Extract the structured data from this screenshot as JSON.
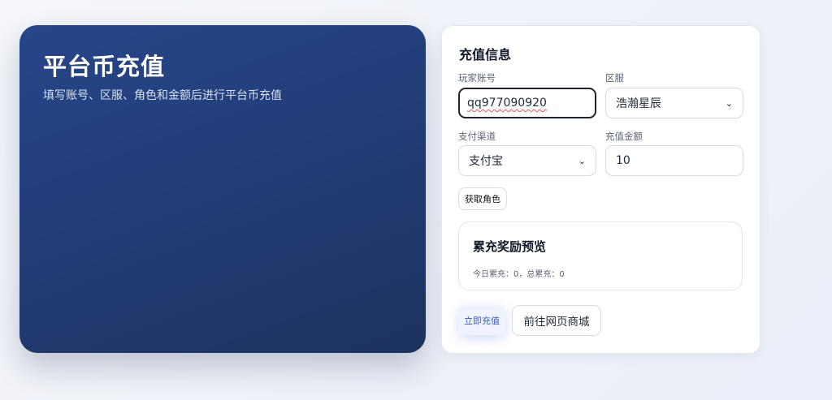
{
  "hero": {
    "title": "平台币充值",
    "subtitle": "填写账号、区服、角色和金额后进行平台币充值"
  },
  "form": {
    "title": "充值信息",
    "account_label": "玩家账号",
    "account_value": "qq977090920",
    "server_label": "区服",
    "server_value": "浩瀚星辰",
    "payment_label": "支付渠道",
    "payment_value": "支付宝",
    "amount_label": "充值金额",
    "amount_value": "10",
    "fetch_role_button": "获取角色"
  },
  "reward": {
    "title": "累充奖励预览",
    "stats": "今日累充：0，总累充：0"
  },
  "actions": {
    "recharge_button": "立即充值",
    "shop_button": "前往网页商城"
  },
  "colors": {
    "hero_gradient_start": "#27468a",
    "hero_gradient_end": "#1d3260",
    "primary_text": "#3d5fb0"
  },
  "icons": {
    "select_arrow": "chevron-down-icon"
  }
}
